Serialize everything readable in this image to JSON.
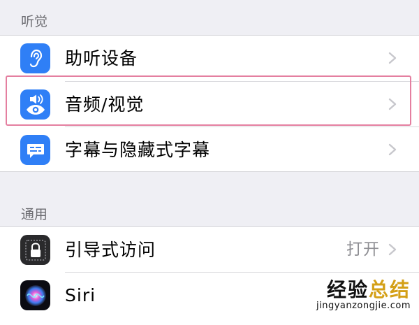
{
  "sections": {
    "hearing": {
      "header": "听觉"
    },
    "general": {
      "header": "通用"
    }
  },
  "rows": {
    "hearing_devices": {
      "label": "助听设备",
      "icon": "ear-icon",
      "icon_color": "#2f7ff6"
    },
    "audio_visual": {
      "label": "音频/视觉",
      "icon": "speaker-eye-icon",
      "icon_color": "#2f7ff6"
    },
    "subtitles": {
      "label": "字幕与隐藏式字幕",
      "icon": "caption-icon",
      "icon_color": "#2f7ff6"
    },
    "guided_access": {
      "label": "引导式访问",
      "value": "打开",
      "icon": "lock-icon",
      "icon_color": "#2a2a2c"
    },
    "siri": {
      "label": "Siri",
      "icon": "siri-icon"
    }
  },
  "watermark": {
    "main_prefix": "经验",
    "main_accent": "总结",
    "sub": "jingyanzongjie.com"
  },
  "colors": {
    "background": "#efeff4",
    "highlight_border": "#e47fa0",
    "chevron": "#c7c7cc",
    "secondary_text": "#8e8e93"
  }
}
